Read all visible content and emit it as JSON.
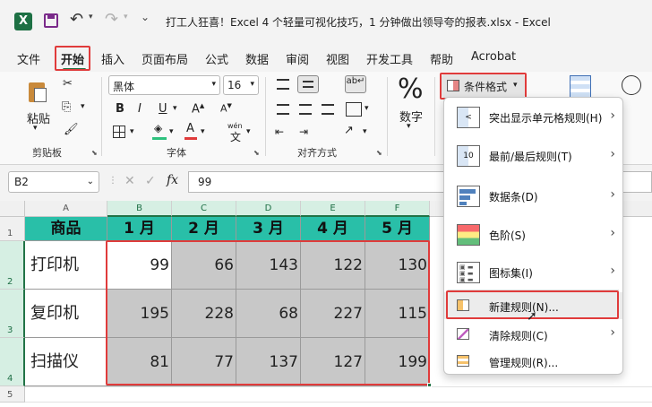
{
  "titlebar": {
    "title": "打工人狂喜！Excel 4 个轻量可视化技巧，1 分钟做出领导夸的报表.xlsx  -  Excel"
  },
  "menu": [
    "文件",
    "开始",
    "插入",
    "页面布局",
    "公式",
    "数据",
    "审阅",
    "视图",
    "开发工具",
    "帮助",
    "Acrobat"
  ],
  "ribbon": {
    "paste_label": "粘贴",
    "clipboard_group": "剪贴板",
    "font_name": "黑体",
    "font_size": "16",
    "font_group": "字体",
    "align_group": "对齐方式",
    "number_label": "数字",
    "number_group": "数字",
    "wen_label": "wén",
    "cf_button": "条件格式"
  },
  "formula": {
    "name_box": "B2",
    "fx": "fx",
    "value": "99"
  },
  "grid": {
    "columns": [
      "A",
      "B",
      "C",
      "D",
      "E",
      "F"
    ],
    "rows": [
      "1",
      "2",
      "3",
      "4",
      "5"
    ],
    "header": [
      "商品",
      "1 月",
      "2 月",
      "3 月",
      "4 月",
      "5 月"
    ],
    "data": [
      {
        "name": "打印机",
        "values": [
          "99",
          "66",
          "143",
          "122",
          "130"
        ]
      },
      {
        "name": "复印机",
        "values": [
          "195",
          "228",
          "68",
          "227",
          "115"
        ]
      },
      {
        "name": "扫描仪",
        "values": [
          "81",
          "77",
          "137",
          "127",
          "199"
        ]
      }
    ]
  },
  "cf_menu": {
    "items": [
      {
        "label": "突出显示单元格规则(H)",
        "arrow": "›"
      },
      {
        "label": "最前/最后规则(T)",
        "arrow": "›"
      },
      {
        "label": "数据条(D)",
        "arrow": "›"
      },
      {
        "label": "色阶(S)",
        "arrow": "›"
      },
      {
        "label": "图标集(I)",
        "arrow": "›"
      }
    ],
    "small_items": [
      {
        "label": "新建规则(N)...",
        "arrow": ""
      },
      {
        "label": "清除规则(C)",
        "arrow": "›"
      },
      {
        "label": "管理规则(R)...",
        "arrow": ""
      }
    ]
  },
  "colors": {
    "excel_green": "#217346",
    "header_teal": "#29bfa8",
    "highlight_red": "#e03b3b",
    "data_gray": "#c8c8c8"
  }
}
